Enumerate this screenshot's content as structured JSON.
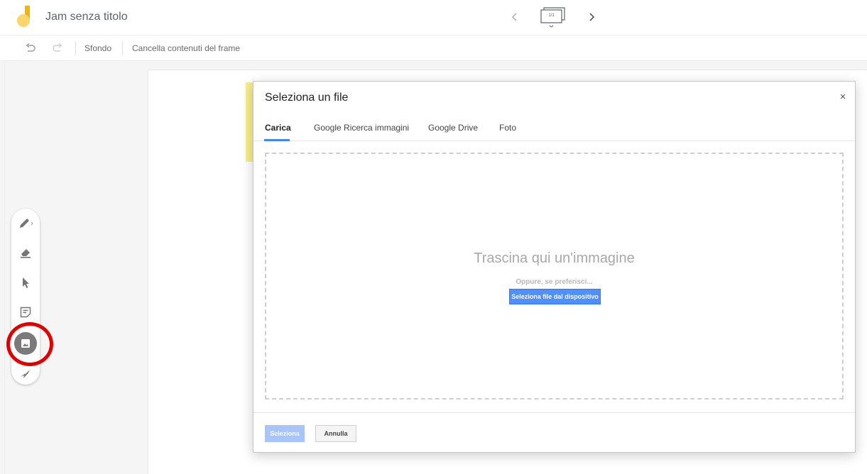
{
  "app": {
    "title": "Jam senza titolo",
    "logo_icon": "jamboard-logo-icon",
    "frame_counter": "1/1",
    "accent_color": "#4285f4",
    "logo_color": "#f4b400"
  },
  "toolbar": {
    "undo_icon": "undo-icon",
    "redo_icon": "redo-icon",
    "background_label": "Sfondo",
    "clear_frame_label": "Cancella contenuti del frame"
  },
  "tools": [
    {
      "name": "pen",
      "icon": "pen-icon"
    },
    {
      "name": "eraser",
      "icon": "eraser-icon"
    },
    {
      "name": "select",
      "icon": "cursor-icon"
    },
    {
      "name": "sticky-note",
      "icon": "sticky-note-icon"
    },
    {
      "name": "image",
      "icon": "image-icon",
      "active": true
    },
    {
      "name": "laser",
      "icon": "laser-icon"
    }
  ],
  "dialog": {
    "title": "Seleziona un file",
    "close_label": "×",
    "tabs": [
      {
        "label": "Carica",
        "active": true
      },
      {
        "label": "Google Ricerca immagini"
      },
      {
        "label": "Google Drive"
      },
      {
        "label": "Foto"
      }
    ],
    "drop_title": "Trascina qui un'immagine",
    "drop_or": "Oppure, se preferisci...",
    "pick_device_label": "Seleziona file dal dispositivo",
    "select_label": "Seleziona",
    "cancel_label": "Annulla"
  }
}
